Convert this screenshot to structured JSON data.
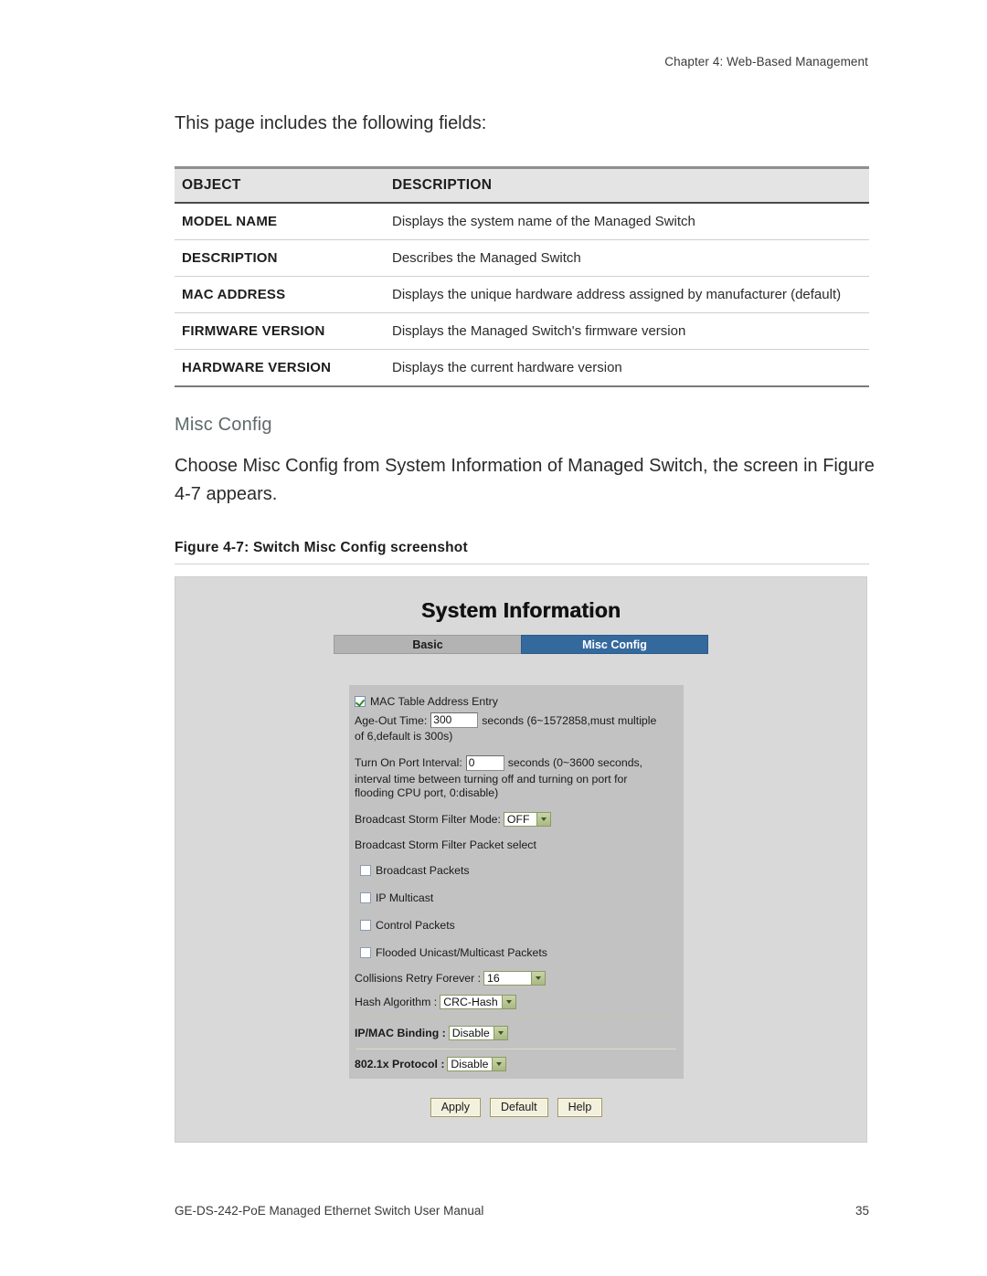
{
  "header": {
    "running_head": "Chapter 4: Web-Based Management"
  },
  "intro": {
    "lead": "This page includes the following fields:"
  },
  "spec_table": {
    "columns": [
      "OBJECT",
      "DESCRIPTION"
    ],
    "rows": [
      {
        "object": "MODEL NAME",
        "description": "Displays the system name of the Managed Switch"
      },
      {
        "object": "DESCRIPTION",
        "description": "Describes the Managed Switch"
      },
      {
        "object": "MAC ADDRESS",
        "description": "Displays the unique hardware address assigned by manufacturer (default)"
      },
      {
        "object": "FIRMWARE VERSION",
        "description": "Displays the Managed Switch's firmware version"
      },
      {
        "object": "HARDWARE VERSION",
        "description": "Displays the current hardware version"
      }
    ]
  },
  "section": {
    "heading": "Misc Config",
    "paragraph": "Choose Misc Config from System Information of Managed Switch, the screen in Figure 4-7 appears."
  },
  "figure": {
    "caption": "Figure 4-7:  Switch Misc Config screenshot"
  },
  "screenshot": {
    "title": "System Information",
    "tabs": [
      {
        "label": "Basic",
        "active": false
      },
      {
        "label": "Misc Config",
        "active": true
      }
    ],
    "mac_table": {
      "checkbox_label": "MAC Table Address Entry",
      "checked": true
    },
    "age_out": {
      "label": "Age-Out Time:",
      "value": "300",
      "hint_line1": "seconds (6~1572858,must multiple",
      "hint_line2": "of 6,default is 300s)"
    },
    "turn_on_port": {
      "label": "Turn On Port Interval:",
      "value": "0",
      "hint_line1": "seconds (0~3600 seconds,",
      "hint_line2": "interval time between turning off and turning on port for",
      "hint_line3": "flooding CPU port, 0:disable)"
    },
    "storm_filter_mode": {
      "label": "Broadcast Storm Filter Mode:",
      "value": "OFF"
    },
    "packet_select": {
      "label": "Broadcast Storm Filter Packet select",
      "options": [
        {
          "label": "Broadcast Packets",
          "checked": false
        },
        {
          "label": "IP Multicast",
          "checked": false
        },
        {
          "label": "Control Packets",
          "checked": false
        },
        {
          "label": "Flooded Unicast/Multicast Packets",
          "checked": false
        }
      ]
    },
    "collisions_retry": {
      "label": "Collisions Retry Forever :",
      "value": "16"
    },
    "hash_algorithm": {
      "label": "Hash Algorithm :",
      "value": "CRC-Hash"
    },
    "ip_mac_binding": {
      "label": "IP/MAC Binding :",
      "value": "Disable"
    },
    "dot1x_protocol": {
      "label": "802.1x Protocol :",
      "value": "Disable"
    },
    "buttons": [
      {
        "label": "Apply"
      },
      {
        "label": "Default"
      },
      {
        "label": "Help"
      }
    ],
    "colors": {
      "active_tab": "#34699e",
      "inactive_tab": "#b3b3b3",
      "panel_bg": "#c2c2c2",
      "frame_bg": "#d9d9d9",
      "button_bg": "#f3f0dd",
      "select_border": "#8a9a63"
    }
  },
  "footer": {
    "manual_title": "GE-DS-242-PoE Managed Ethernet Switch User Manual",
    "page_number": "35"
  }
}
